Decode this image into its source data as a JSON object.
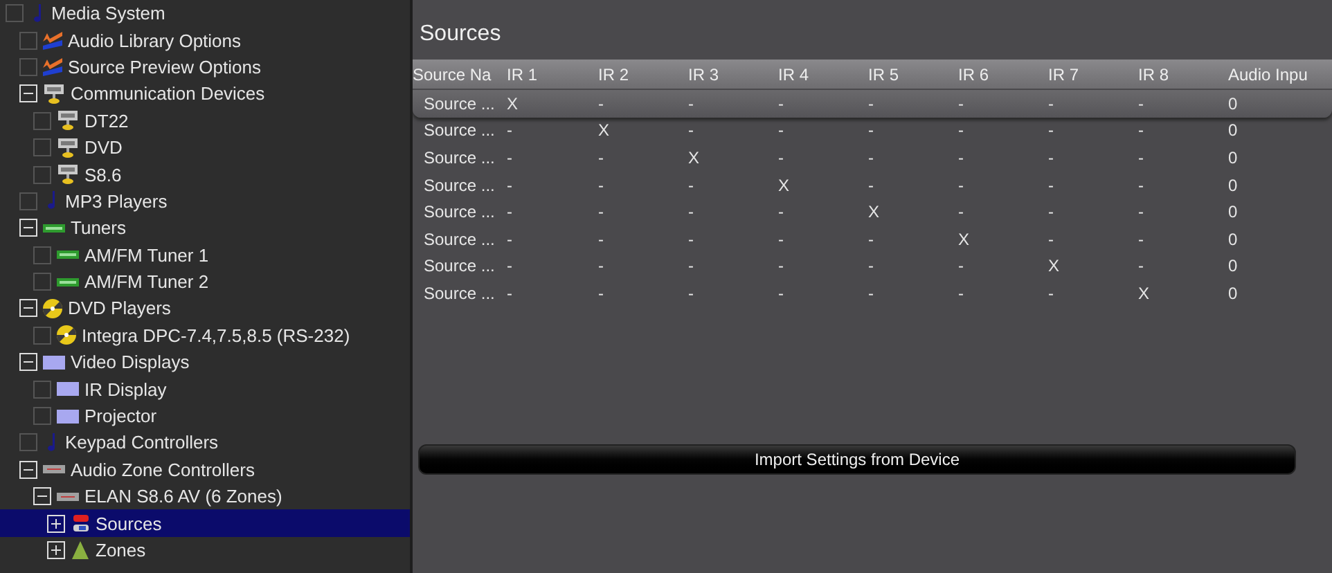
{
  "tree": [
    {
      "label": "Media System",
      "kind": "note",
      "selected": false,
      "children": [
        {
          "label": "Audio Library Options",
          "kind": "library",
          "selected": false
        },
        {
          "label": "Source Preview Options",
          "kind": "library",
          "selected": false
        },
        {
          "label": "Communication Devices",
          "kind": "network",
          "selected": false,
          "expanded": true,
          "children": [
            {
              "label": "DT22",
              "kind": "network",
              "selected": false
            },
            {
              "label": "DVD",
              "kind": "network",
              "selected": false
            },
            {
              "label": "S8.6",
              "kind": "network",
              "selected": false
            }
          ]
        },
        {
          "label": "MP3 Players",
          "kind": "note",
          "selected": false
        },
        {
          "label": "Tuners",
          "kind": "tuner",
          "selected": false,
          "expanded": true,
          "children": [
            {
              "label": "AM/FM Tuner 1",
              "kind": "tuner",
              "selected": false
            },
            {
              "label": "AM/FM Tuner 2",
              "kind": "tuner",
              "selected": false
            }
          ]
        },
        {
          "label": "DVD Players",
          "kind": "disc",
          "selected": false,
          "expanded": true,
          "children": [
            {
              "label": "Integra DPC-7.4,7.5,8.5 (RS-232)",
              "kind": "disc",
              "selected": false
            }
          ]
        },
        {
          "label": "Video Displays",
          "kind": "display",
          "selected": false,
          "expanded": true,
          "children": [
            {
              "label": "IR Display",
              "kind": "display",
              "selected": false
            },
            {
              "label": "Projector",
              "kind": "display",
              "selected": false
            }
          ]
        },
        {
          "label": "Keypad Controllers",
          "kind": "note",
          "selected": false
        },
        {
          "label": "Audio Zone Controllers",
          "kind": "amp",
          "selected": false,
          "expanded": true,
          "children": [
            {
              "label": "ELAN S8.6 AV (6 Zones)",
              "kind": "amp",
              "selected": false,
              "expanded": true,
              "children": [
                {
                  "label": "Sources",
                  "kind": "plugs",
                  "selected": true,
                  "expanded": false
                },
                {
                  "label": "Zones",
                  "kind": "cone",
                  "selected": false,
                  "expanded": false
                }
              ]
            }
          ]
        }
      ]
    }
  ],
  "panel": {
    "title": "Sources",
    "table": {
      "columns": [
        "Source Na",
        "IR 1",
        "IR 2",
        "IR 3",
        "IR 4",
        "IR 5",
        "IR 6",
        "IR 7",
        "IR 8",
        "Audio Inpu"
      ],
      "rows": [
        {
          "selected": true,
          "cells": [
            "Source ...",
            "X",
            "-",
            "-",
            "-",
            "-",
            "-",
            "-",
            "-",
            "0"
          ]
        },
        {
          "selected": false,
          "cells": [
            "Source ...",
            "-",
            "X",
            "-",
            "-",
            "-",
            "-",
            "-",
            "-",
            "0"
          ]
        },
        {
          "selected": false,
          "cells": [
            "Source ...",
            "-",
            "-",
            "X",
            "-",
            "-",
            "-",
            "-",
            "-",
            "0"
          ]
        },
        {
          "selected": false,
          "cells": [
            "Source ...",
            "-",
            "-",
            "-",
            "X",
            "-",
            "-",
            "-",
            "-",
            "0"
          ]
        },
        {
          "selected": false,
          "cells": [
            "Source ...",
            "-",
            "-",
            "-",
            "-",
            "X",
            "-",
            "-",
            "-",
            "0"
          ]
        },
        {
          "selected": false,
          "cells": [
            "Source ...",
            "-",
            "-",
            "-",
            "-",
            "-",
            "X",
            "-",
            "-",
            "0"
          ]
        },
        {
          "selected": false,
          "cells": [
            "Source ...",
            "-",
            "-",
            "-",
            "-",
            "-",
            "-",
            "X",
            "-",
            "0"
          ]
        },
        {
          "selected": false,
          "cells": [
            "Source ...",
            "-",
            "-",
            "-",
            "-",
            "-",
            "-",
            "-",
            "X",
            "0"
          ]
        }
      ]
    },
    "button": "Import Settings from Device"
  }
}
